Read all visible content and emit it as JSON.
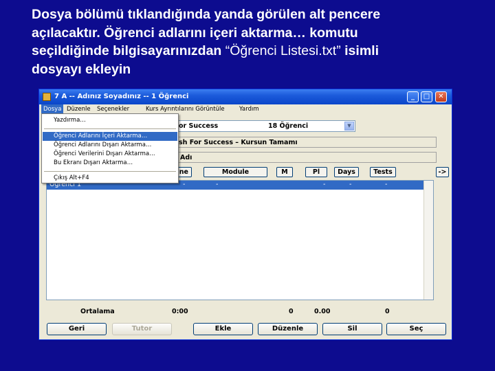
{
  "caption": {
    "line1": "Dosya bölümü tıklandığında yanda görülen alt pencere",
    "line2": "açılacaktır. Öğrenci adlarını içeri aktarma…  komutu",
    "line3a": "seçildiğinde bilgisayarınızdan ",
    "line3b": "“Öğrenci Listesi.txt”",
    "line3c": " isimli",
    "line4": "dosyayı ekleyin"
  },
  "window": {
    "title": "7 A -- Adınız Soyadınız -- 1 Öğrenci",
    "min_glyph": "_",
    "max_glyph": "□",
    "close_glyph": "✕"
  },
  "menubar": {
    "items": [
      "Dosya",
      "Düzenle",
      "Seçenekler",
      "Kurs Ayrıntılarını Görüntüle",
      "Yardım"
    ]
  },
  "dosya_menu": {
    "items": [
      "Yazdırma…",
      "Öğrenci Adlarını İçeri Aktarma…",
      "Öğrenci Adlarını Dışarı Aktarma…",
      "Öğrenci Verilerini Dışarı Aktarma…",
      "Bu Ekranı Dışarı Aktarma…",
      "Çıkış Alt+F4"
    ]
  },
  "form": {
    "course_partial": "or Success",
    "student_count": "18 Öğrenci",
    "course_status_partial": "sh For Success  –  Kursun Tamamı",
    "name_label_partial": "Adı",
    "header_partial": "ne",
    "header_buttons": [
      "Module",
      "M",
      "Pl",
      "Days",
      "Tests",
      "->"
    ]
  },
  "list": {
    "rows": [
      {
        "name": "Öğrenci 1",
        "c1": "-",
        "c2": "-",
        "c3": "-",
        "c4": "-",
        "c5": "-"
      }
    ]
  },
  "averages": {
    "label": "Ortalama",
    "time": "0:00",
    "v1": "0",
    "v2": "0.00",
    "v3": "0"
  },
  "buttons": {
    "geri": "Geri",
    "tutor": "Tutor",
    "ekle": "Ekle",
    "duzenle": "Düzenle",
    "sil": "Sil",
    "sec": "Seç"
  }
}
